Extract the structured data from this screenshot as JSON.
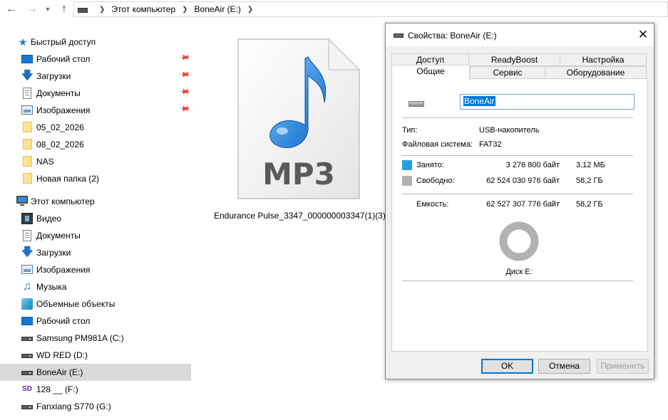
{
  "address_bar": {
    "crumbs": [
      "Этот компьютер",
      "BoneAir (E:)"
    ]
  },
  "sidebar": {
    "quick_access": {
      "label": "Быстрый доступ",
      "items": [
        {
          "label": "Рабочий стол",
          "icon": "desktop-icon",
          "pinned": true
        },
        {
          "label": "Загрузки",
          "icon": "download-arrow-icon",
          "pinned": true
        },
        {
          "label": "Документы",
          "icon": "document-icon",
          "pinned": true
        },
        {
          "label": "Изображения",
          "icon": "pictures-icon",
          "pinned": true
        },
        {
          "label": "05_02_2026",
          "icon": "folder-icon",
          "pinned": false
        },
        {
          "label": "08_02_2026",
          "icon": "folder-icon",
          "pinned": false
        },
        {
          "label": "NAS",
          "icon": "folder-icon",
          "pinned": false
        },
        {
          "label": "Новая папка (2)",
          "icon": "folder-icon",
          "pinned": false
        }
      ]
    },
    "this_pc": {
      "label": "Этот компьютер",
      "items": [
        {
          "label": "Видео",
          "icon": "video-icon"
        },
        {
          "label": "Документы",
          "icon": "document-icon"
        },
        {
          "label": "Загрузки",
          "icon": "download-arrow-icon"
        },
        {
          "label": "Изображения",
          "icon": "pictures-icon"
        },
        {
          "label": "Музыка",
          "icon": "music-note-icon"
        },
        {
          "label": "Объемные объекты",
          "icon": "3d-objects-icon"
        },
        {
          "label": "Рабочий стол",
          "icon": "desktop-icon"
        },
        {
          "label": "Samsung PM981A (C:)",
          "icon": "drive-icon"
        },
        {
          "label": "WD RED (D:)",
          "icon": "drive-icon"
        },
        {
          "label": "BoneAir (E:)",
          "icon": "drive-icon",
          "selected": true
        },
        {
          "label": "128 __ (F:)",
          "icon": "sd-card-icon"
        },
        {
          "label": "Fanxiang S770 (G:)",
          "icon": "drive-icon"
        }
      ]
    }
  },
  "content": {
    "file": {
      "name": "Endurance Pulse_3347_000000003347(1)(3)",
      "icon": "mp3-file-icon",
      "badge": "MP3"
    }
  },
  "dialog": {
    "title": "Свойства: BoneAir (E:)",
    "tabs_row1": [
      "Доступ",
      "ReadyBoost",
      "Настройка"
    ],
    "tabs_row2": [
      "Общие",
      "Сервис",
      "Оборудование"
    ],
    "active_tab": "Общие",
    "volume_name": "BoneAir",
    "type_label": "Тип:",
    "type_value": "USB-накопитель",
    "fs_label": "Файловая система:",
    "fs_value": "FAT32",
    "used": {
      "label": "Занято:",
      "bytes": "3 276 800 байт",
      "size": "3,12 МБ",
      "color": "#26a0da"
    },
    "free": {
      "label": "Свободно:",
      "bytes": "62 524 030 976 байт",
      "size": "58,2 ГБ",
      "color": "#b2b2b2"
    },
    "capacity": {
      "label": "Емкость:",
      "bytes": "62 527 307 776 байт",
      "size": "58,2 ГБ"
    },
    "used_fraction": 5.24e-05,
    "disk_label": "Диск E:",
    "buttons": {
      "ok": "OK",
      "cancel": "Отмена",
      "apply": "Применить"
    }
  }
}
